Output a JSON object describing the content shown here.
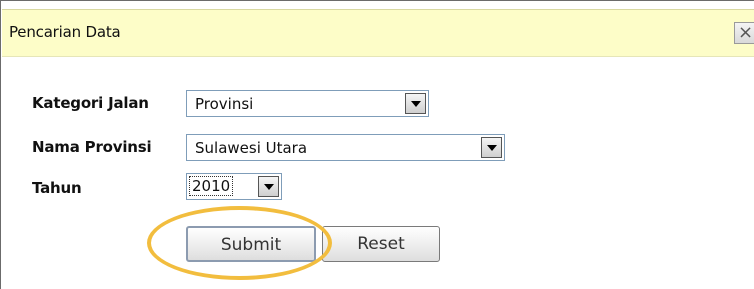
{
  "dialog": {
    "title": "Pencarian Data",
    "close_icon": "close-icon"
  },
  "form": {
    "kategori_label": "Kategori Jalan",
    "kategori_value": "Provinsi",
    "provinsi_label": "Nama Provinsi",
    "provinsi_value": "Sulawesi Utara",
    "tahun_label": "Tahun",
    "tahun_value": "2010"
  },
  "buttons": {
    "submit_label": "Submit",
    "reset_label": "Reset"
  },
  "colors": {
    "titlebar_bg": "#fdfdc8",
    "highlight": "#f2bd3e"
  }
}
